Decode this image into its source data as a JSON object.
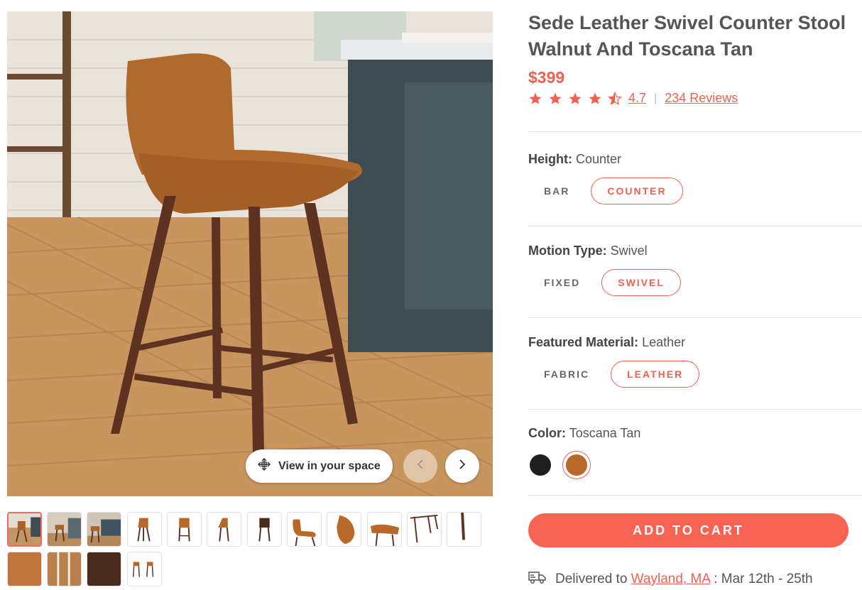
{
  "product": {
    "title": "Sede Leather Swivel Counter Stool Walnut And Toscana Tan",
    "price": "$399",
    "rating": "4.7",
    "rating_fraction": 0.94,
    "reviews_link": "234 Reviews"
  },
  "gallery": {
    "view_in_space_label": "View in your space",
    "thumbnail_count": 16
  },
  "options": {
    "height": {
      "label": "Height:",
      "value": "Counter",
      "choices": [
        "BAR",
        "COUNTER"
      ],
      "selected": "COUNTER"
    },
    "motion": {
      "label": "Motion Type:",
      "value": "Swivel",
      "choices": [
        "FIXED",
        "SWIVEL"
      ],
      "selected": "SWIVEL"
    },
    "material": {
      "label": "Featured Material:",
      "value": "Leather",
      "choices": [
        "FABRIC",
        "LEATHER"
      ],
      "selected": "LEATHER"
    },
    "color": {
      "label": "Color:",
      "value": "Toscana Tan",
      "swatches": [
        {
          "name": "black",
          "hex": "#1e1e1e"
        },
        {
          "name": "toscana-tan",
          "hex": "#b8692a"
        }
      ]
    }
  },
  "cart": {
    "label": "ADD TO CART"
  },
  "delivery": {
    "prefix": "Delivered to",
    "location": "Wayland, MA",
    "dates": ": Mar 12th - 25th"
  },
  "colors": {
    "accent": "#f2604f",
    "cart_button": "#f96353"
  }
}
